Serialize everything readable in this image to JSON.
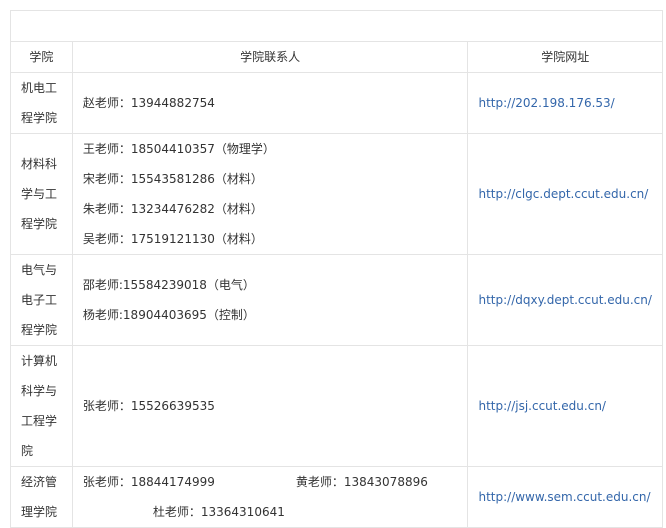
{
  "headers": {
    "college": "学院",
    "contact": "学院联系人",
    "url": "学院网址"
  },
  "rows": [
    {
      "college": "机电工程学院",
      "contacts": [
        "赵老师：13944882754"
      ],
      "url": "http://202.198.176.53/"
    },
    {
      "college": "材料科学与工程学院",
      "contacts": [
        "王老师：18504410357（物理学）",
        "宋老师：15543581286（材料）",
        "朱老师：13234476282（材料）",
        "吴老师：17519121130（材料）"
      ],
      "url": "http://clgc.dept.ccut.edu.cn/"
    },
    {
      "college": "电气与电子工程学院",
      "contacts": [
        "邵老师:15584239018（电气）",
        "杨老师:18904403695（控制）"
      ],
      "url": "http://dqxy.dept.ccut.edu.cn/"
    },
    {
      "college": "计算机科学与工程学院",
      "contacts": [
        "张老师：15526639535"
      ],
      "url": "http://jsj.ccut.edu.cn/"
    },
    {
      "college": "经济管理学院",
      "contacts_pair": [
        "张老师：18844174999",
        "黄老师：13843078896"
      ],
      "contacts": [
        "杜老师：13364310641"
      ],
      "url": "http://www.sem.ccut.edu.cn/"
    }
  ]
}
